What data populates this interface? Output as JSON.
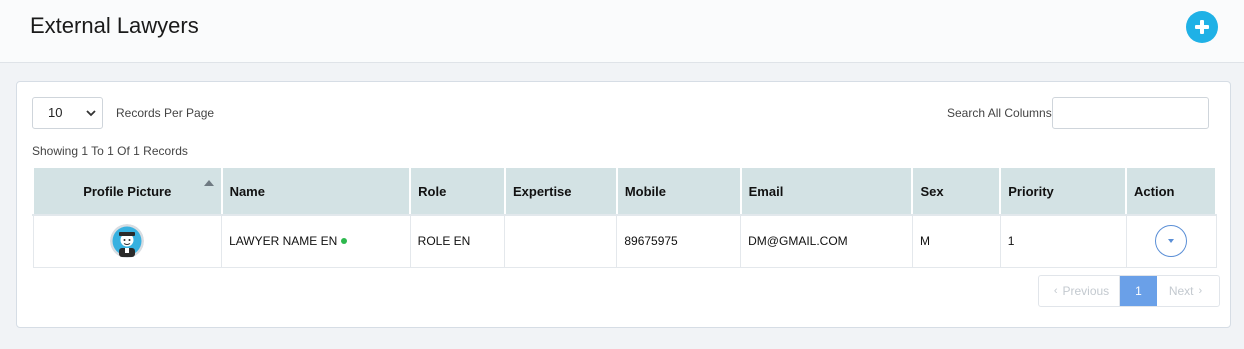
{
  "header": {
    "title": "External Lawyers",
    "add_icon": "plus-circle-icon"
  },
  "controls": {
    "per_page_value": "10",
    "per_page_label": "Records Per Page",
    "search_label": "Search All Columns",
    "search_value": "",
    "showing_text": "Showing 1 To 1 Of 1 Records"
  },
  "table": {
    "columns": [
      "Profile Picture",
      "Name",
      "Role",
      "Expertise",
      "Mobile",
      "Email",
      "Sex",
      "Priority",
      "Action"
    ],
    "sorted_column": "Profile Picture",
    "rows": [
      {
        "avatar_icon": "avatar-icon",
        "name": "LAWYER NAME EN",
        "online_status_color": "#2db84d",
        "role": "ROLE EN",
        "expertise": "",
        "mobile": "89675975",
        "email": "DM@GMAIL.COM",
        "sex": "M",
        "priority": "1",
        "action_icon": "chevron-down-icon"
      }
    ]
  },
  "pagination": {
    "previous": "Previous",
    "current_page": "1",
    "next": "Next"
  },
  "colors": {
    "accent": "#1fb1e6",
    "table_header": "#d3e2e4",
    "active_page": "#6aa0e8",
    "status_online": "#2db84d"
  }
}
